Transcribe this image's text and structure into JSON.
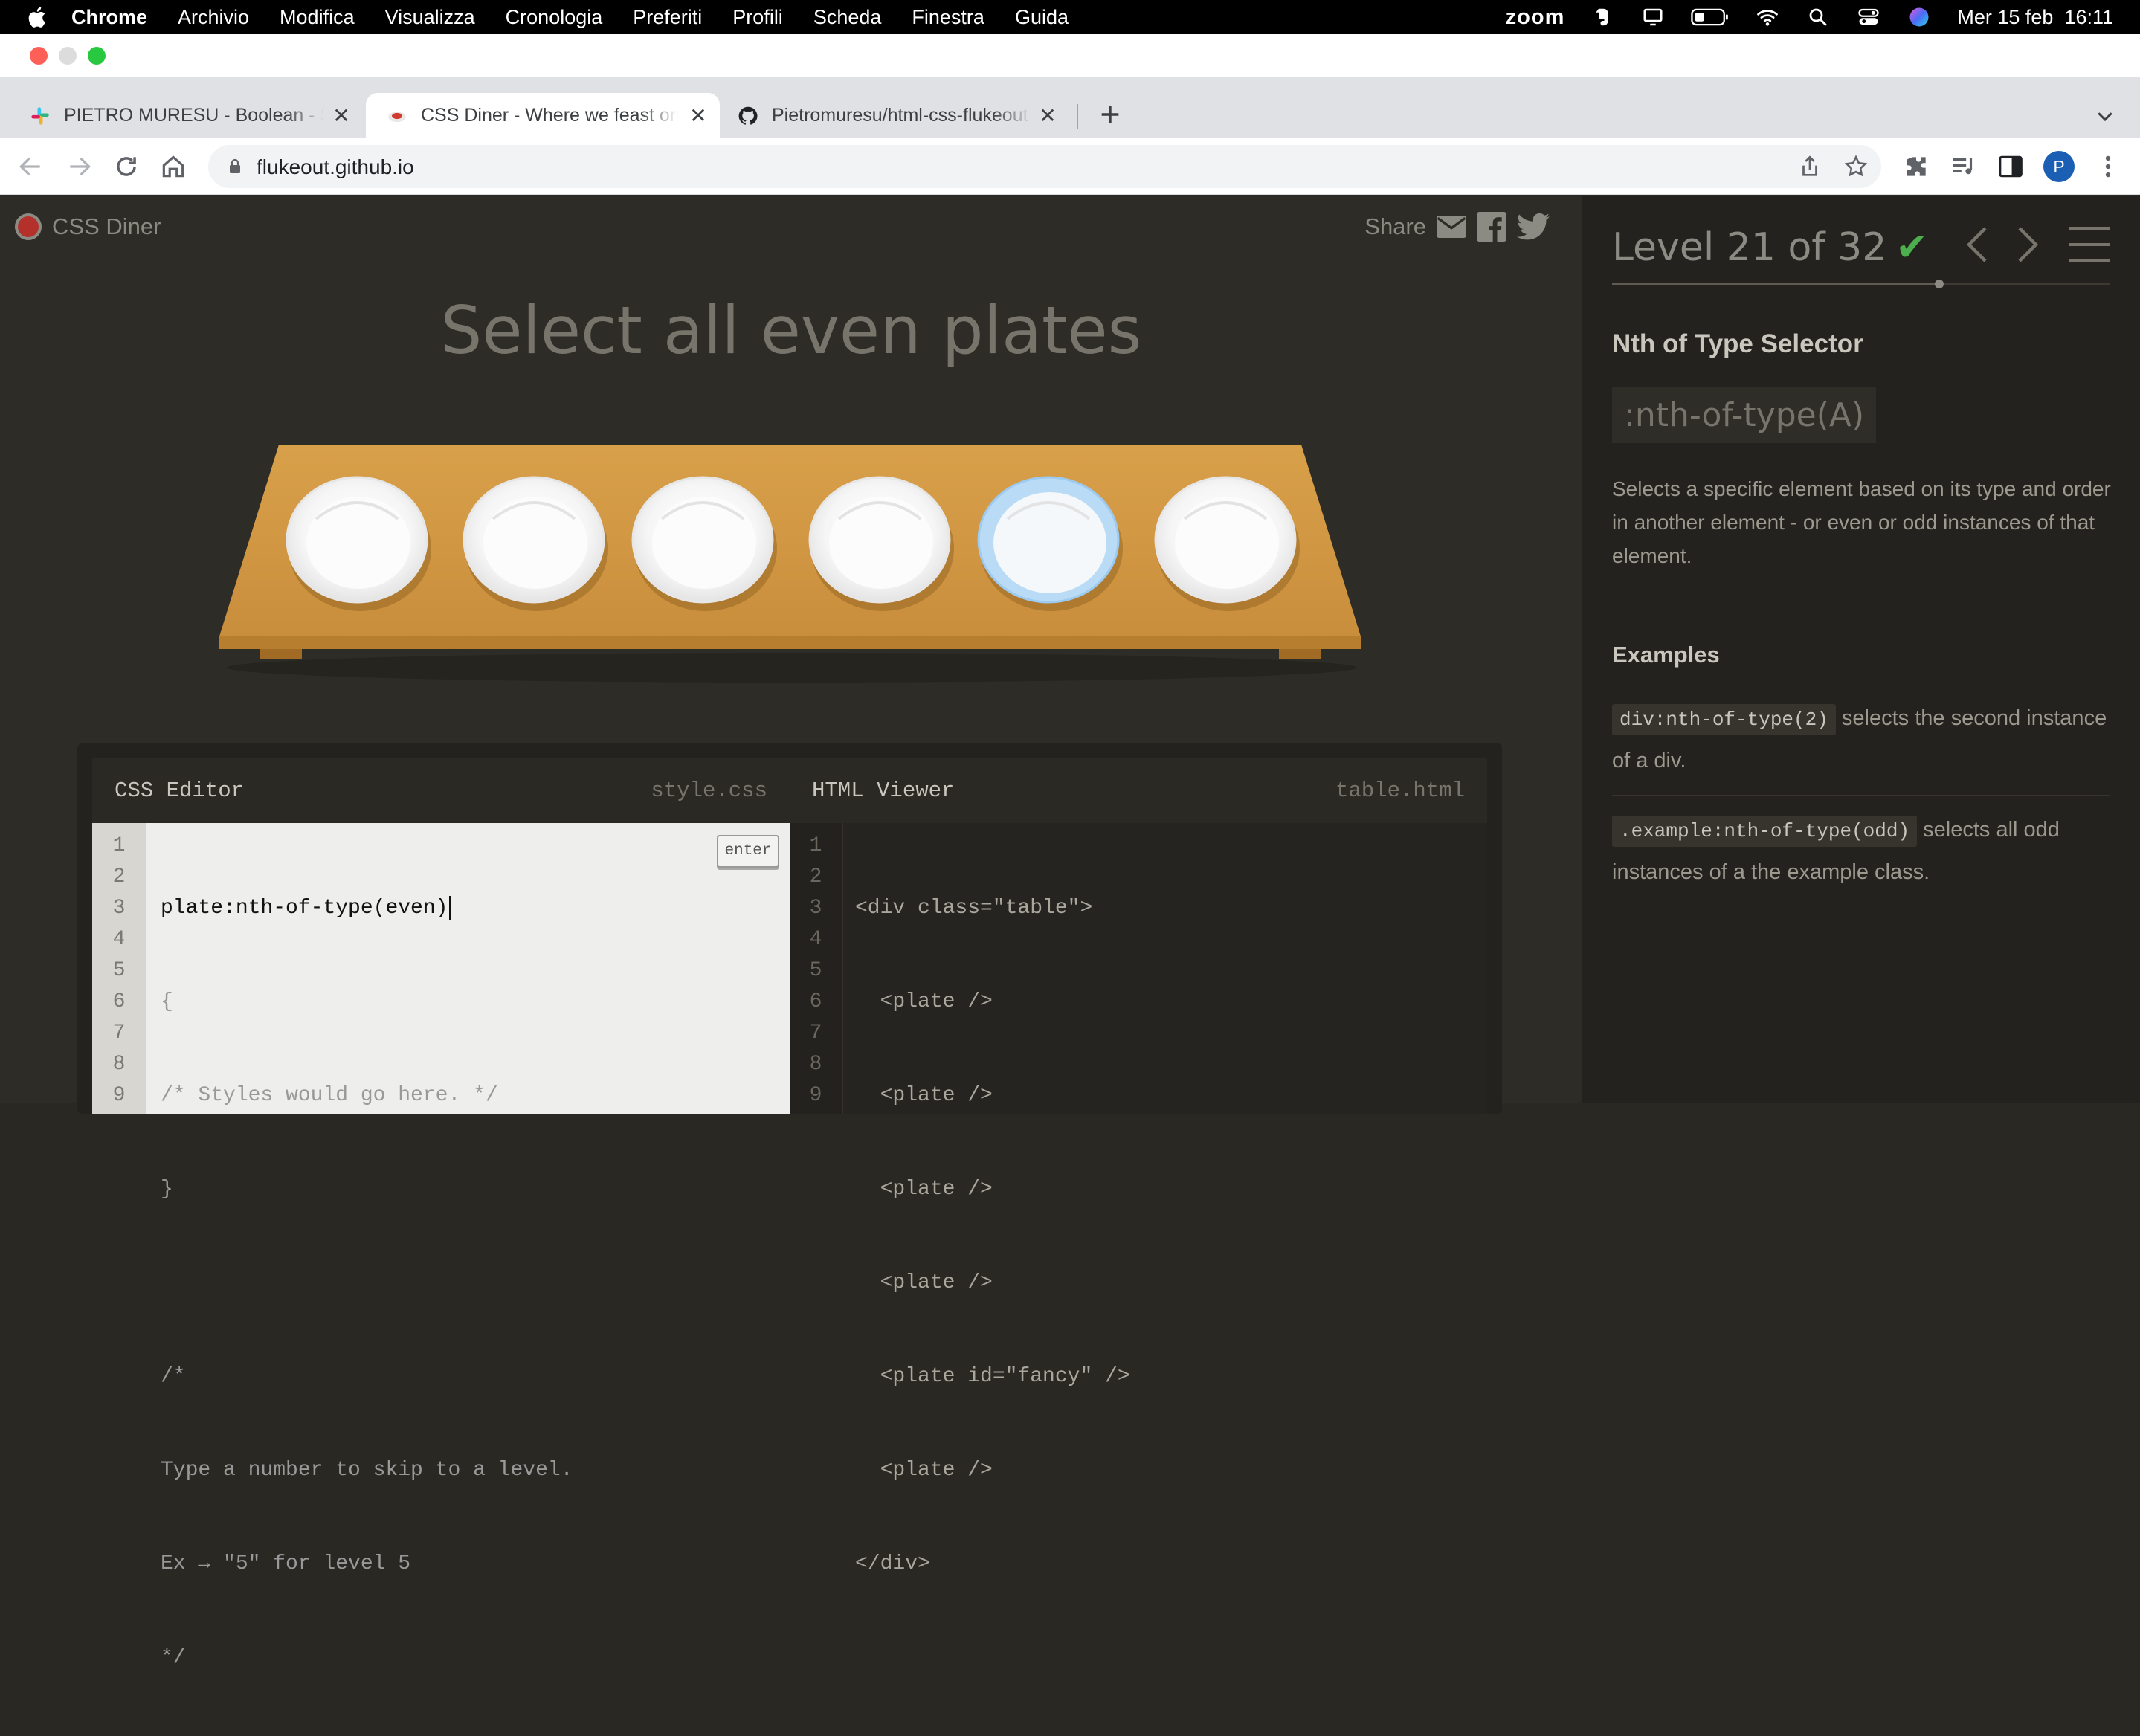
{
  "menubar": {
    "app": "Chrome",
    "items": [
      "Archivio",
      "Modifica",
      "Visualizza",
      "Cronologia",
      "Preferiti",
      "Profili",
      "Scheda",
      "Finestra",
      "Guida"
    ],
    "zoom": "zoom",
    "datetime": "Mer 15 feb  16:11"
  },
  "tabs": [
    {
      "title": "PIETRO MURESU - Boolean - Slack",
      "icon": "slack-icon"
    },
    {
      "title": "CSS Diner - Where we feast on CSS Selectors",
      "icon": "css-diner-icon"
    },
    {
      "title": "Pietromuresu/html-css-flukeout",
      "icon": "github-icon"
    }
  ],
  "toolbar": {
    "url": "flukeout.github.io",
    "avatar": "P"
  },
  "game": {
    "logo": "CSS Diner",
    "share": "Share",
    "order": "Select all even plates",
    "plates": [
      {
        "selected": false
      },
      {
        "selected": false
      },
      {
        "selected": false
      },
      {
        "selected": false
      },
      {
        "selected": true
      },
      {
        "selected": false
      }
    ]
  },
  "css_editor": {
    "title": "CSS Editor",
    "file": "style.css",
    "enter": "enter",
    "line_numbers": [
      "1",
      "2",
      "3",
      "4",
      "5",
      "6",
      "7",
      "8",
      "9"
    ],
    "input": "plate:nth-of-type(even)",
    "lines": [
      "{",
      "/* Styles would go here. */",
      "}",
      "",
      "/*",
      "Type a number to skip to a level.",
      "Ex → \"5\" for level 5",
      "*/"
    ]
  },
  "html_viewer": {
    "title": "HTML Viewer",
    "file": "table.html",
    "line_numbers": [
      "1",
      "2",
      "3",
      "4",
      "5",
      "6",
      "7",
      "8",
      "9"
    ],
    "lines": [
      "<div class=\"table\">",
      "  <plate />",
      "  <plate />",
      "  <plate />",
      "  <plate />",
      "  <plate id=\"fancy\" />",
      "  <plate />",
      "</div>",
      ""
    ]
  },
  "sidebar": {
    "level": "Level 21 of 32",
    "progress": 0.6563,
    "selector_name": "Nth of Type Selector",
    "syntax": ":nth-of-type(A)",
    "description": "Selects a specific element based on its type and order in another element - or even or odd instances of that element.",
    "examples_title": "Examples",
    "examples": [
      {
        "code": "div:nth-of-type(2)",
        "text": "selects the second instance of a div."
      },
      {
        "code": ".example:nth-of-type(odd)",
        "text": "selects all odd instances of a the example class."
      }
    ]
  }
}
